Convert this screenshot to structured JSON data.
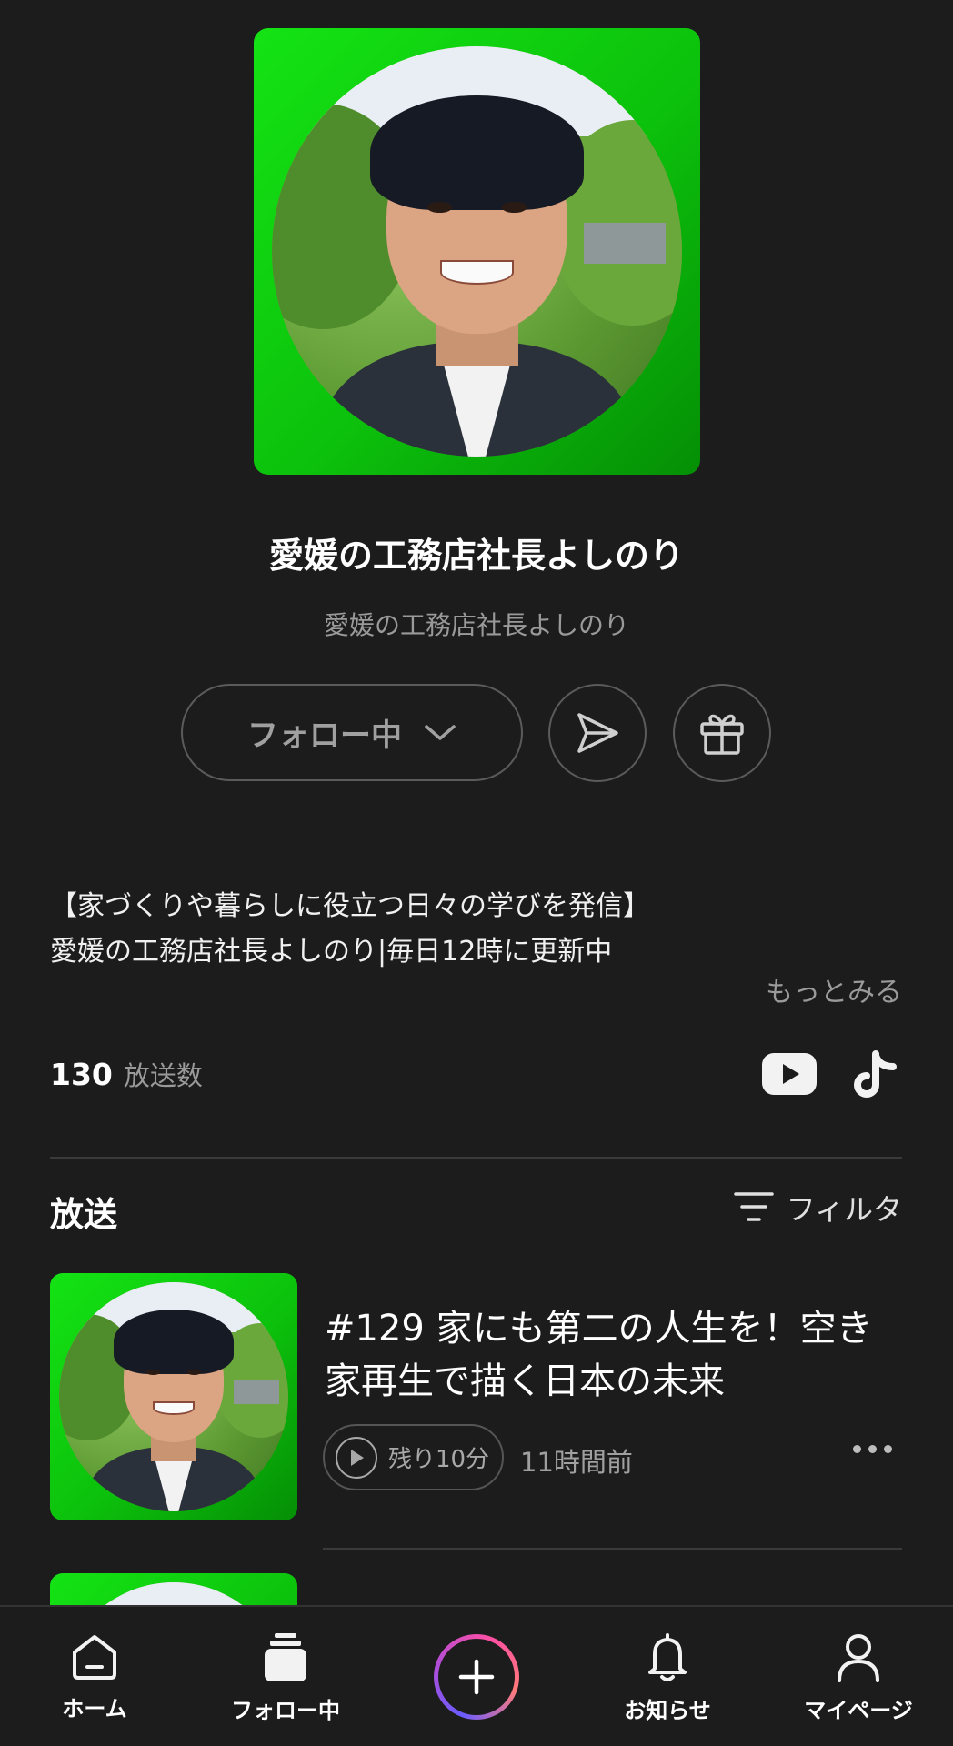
{
  "channel": {
    "title": "愛媛の工務店社長よしのり",
    "subtitle": "愛媛の工務店社長よしのり",
    "follow_label": "フォロー中",
    "description_line1": "【家づくりや暮らしに役立つ日々の学びを発信】",
    "description_line2": "愛媛の工務店社長よしのり|毎日12時に更新中",
    "more_label": "もっとみる",
    "broadcast_count": "130",
    "broadcast_count_label": "放送数"
  },
  "broadcasts": {
    "section_title": "放送",
    "filter_label": "フィルタ",
    "episodes": [
      {
        "title": "#129 家にも第二の人生を！空き家再生で描く日本の未来",
        "remaining": "残り10分",
        "time_ago": "11時間前"
      }
    ]
  },
  "icons": {
    "share": "send-icon",
    "gift": "gift-icon",
    "youtube": "youtube-icon",
    "tiktok": "tiktok-icon",
    "filter": "filter-icon",
    "play": "play-icon",
    "more": "more-icon"
  },
  "nav": {
    "home": "ホーム",
    "follow": "フォロー中",
    "notice": "お知らせ",
    "mypage": "マイページ"
  },
  "colors": {
    "background": "#1c1c1c",
    "cover_green": "#0cc10c",
    "muted_text": "#9a9a9a"
  }
}
